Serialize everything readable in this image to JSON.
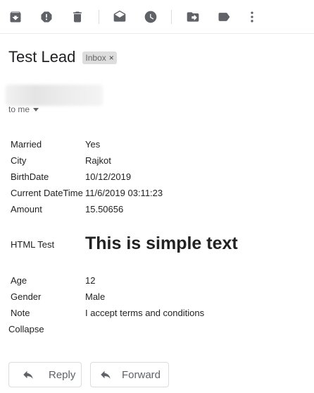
{
  "toolbar": {
    "icons": [
      "archive-icon",
      "report-spam-icon",
      "delete-icon",
      "mark-unread-icon",
      "snooze-icon",
      "move-to-icon",
      "labels-icon",
      "more-icon"
    ]
  },
  "email": {
    "subject": "Test Lead",
    "label": "Inbox",
    "label_close": "×",
    "recipient": "to me"
  },
  "fields": [
    {
      "label": "Married",
      "value": "Yes"
    },
    {
      "label": "City",
      "value": "Rajkot"
    },
    {
      "label": "BirthDate",
      "value": "10/12/2019"
    },
    {
      "label": "Current DateTime",
      "value": "11/6/2019 03:11:23"
    },
    {
      "label": "Amount",
      "value": "15.50656"
    },
    {
      "label": "HTML Test",
      "value": "This is simple text"
    },
    {
      "label": "Age",
      "value": "12"
    },
    {
      "label": "Gender",
      "value": "Male"
    },
    {
      "label": "Note",
      "value": "I accept terms and conditions"
    }
  ],
  "collapse_label": "Collapse",
  "actions": {
    "reply_label": "Reply",
    "forward_label": "Forward"
  }
}
